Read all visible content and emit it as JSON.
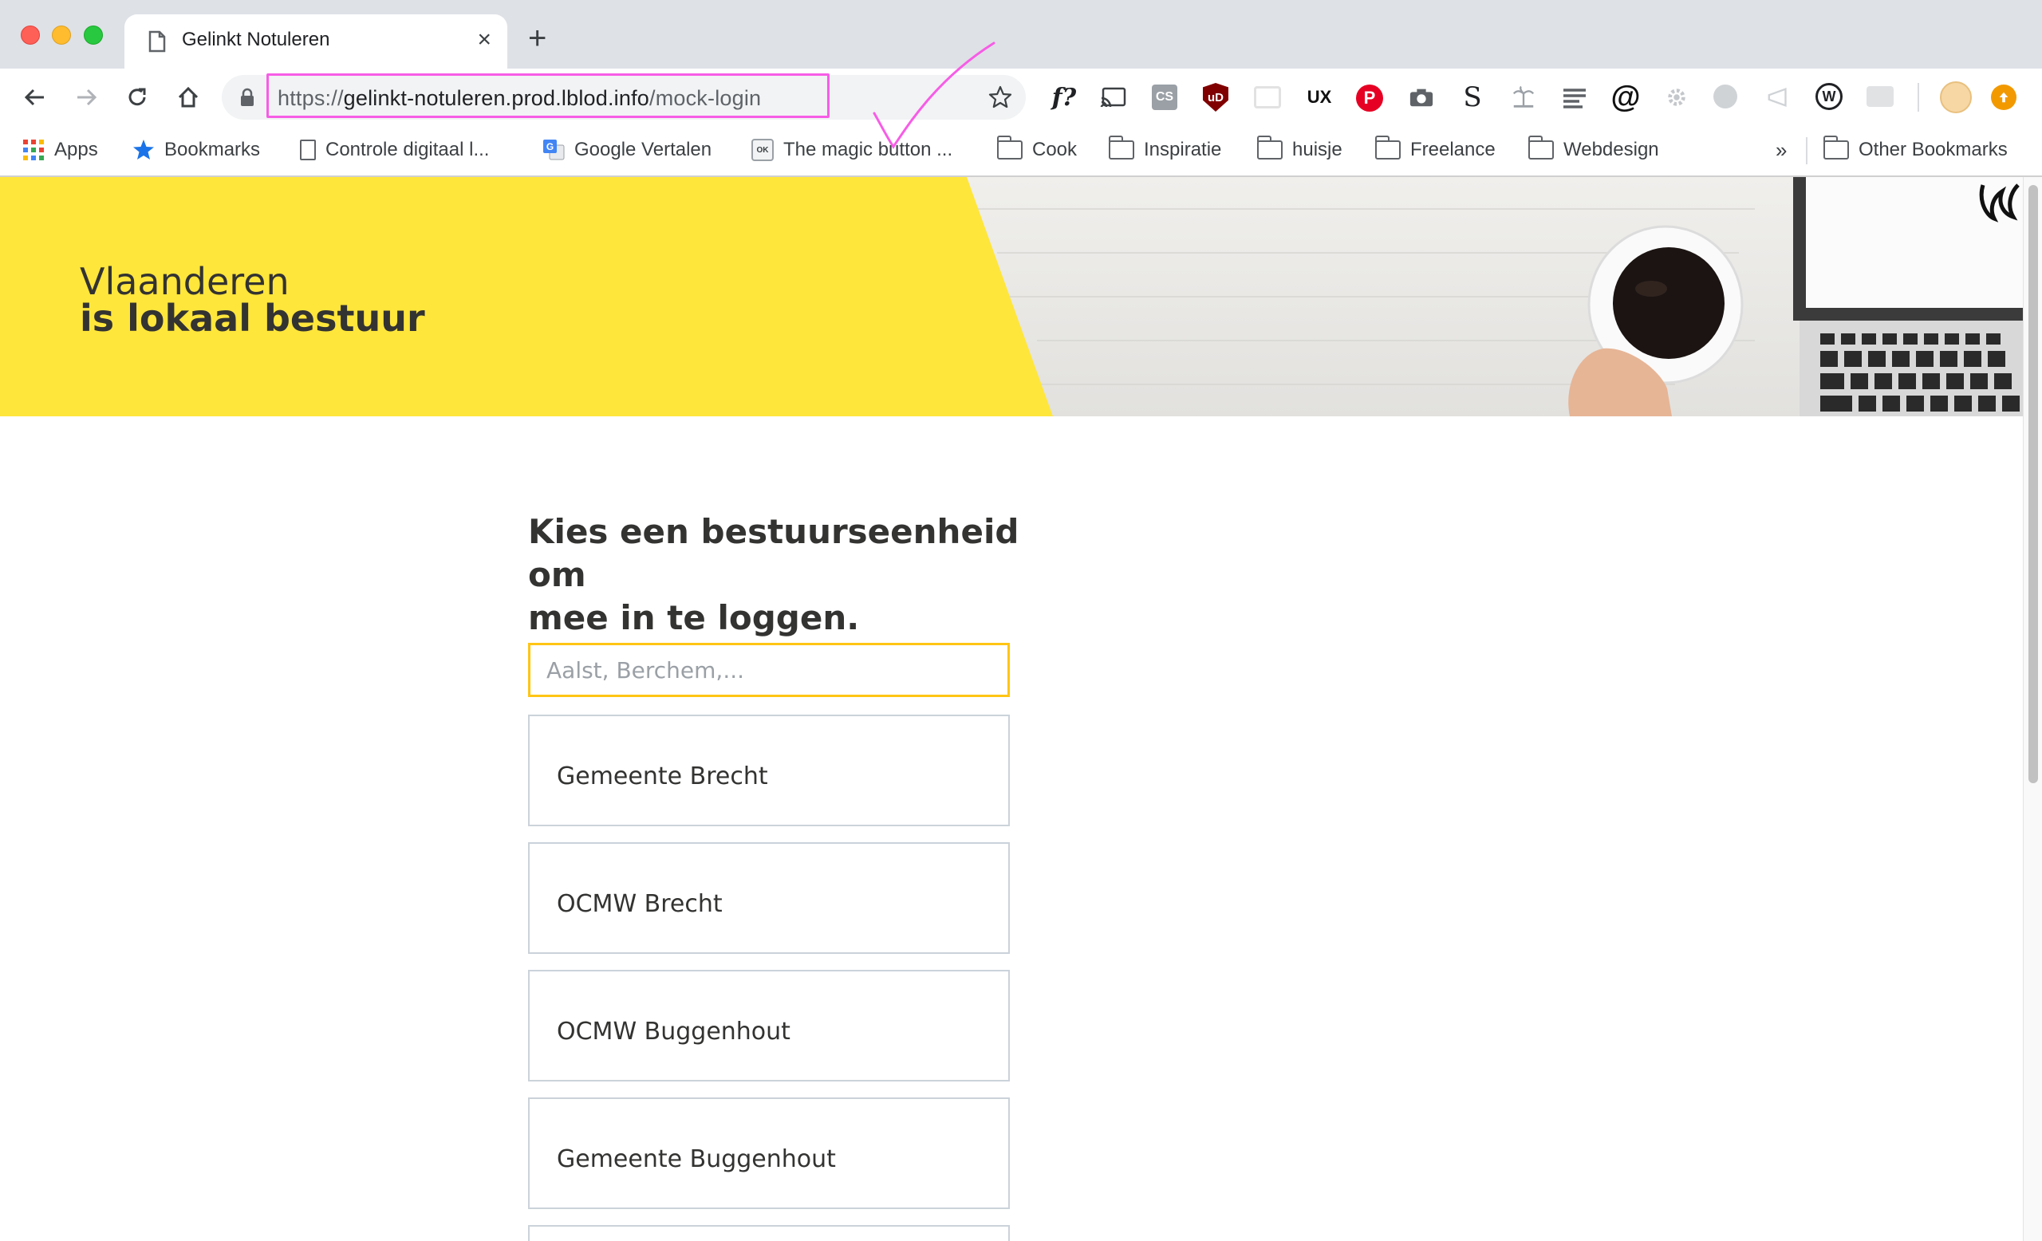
{
  "tab": {
    "title": "Gelinkt Notuleren",
    "close": "×",
    "new_tab": "+"
  },
  "address": {
    "scheme": "https://",
    "host": "gelinkt-notuleren.prod.lblod.info",
    "path": "/mock-login"
  },
  "extensions": {
    "fq_label": "f?",
    "lastfm_label": "CS",
    "ublock_label": "uD",
    "ux_label": "UX",
    "pinterest_label": "P",
    "s_label": "S",
    "at_label": "@",
    "w_label": "W"
  },
  "bookmarks": {
    "items": [
      {
        "label": "Apps",
        "icon": "apps-grid-icon"
      },
      {
        "label": "Bookmarks",
        "icon": "star-icon"
      },
      {
        "label": "Controle digitaal l...",
        "icon": "page-icon"
      },
      {
        "label": "Google Vertalen",
        "icon": "google-translate-icon"
      },
      {
        "label": "The magic button ...",
        "icon": "ok-icon"
      },
      {
        "label": "Cook",
        "icon": "folder-icon"
      },
      {
        "label": "Inspiratie",
        "icon": "folder-icon"
      },
      {
        "label": "huisje",
        "icon": "folder-icon"
      },
      {
        "label": "Freelance",
        "icon": "folder-icon"
      },
      {
        "label": "Webdesign",
        "icon": "folder-icon"
      }
    ],
    "overflow": "»",
    "other": "Other Bookmarks"
  },
  "banner": {
    "line1": "Vlaanderen",
    "line2": "is lokaal bestuur"
  },
  "login": {
    "heading_line1": "Kies een bestuurseenheid om",
    "heading_line2": "mee in te loggen.",
    "search_placeholder": "Aalst, Berchem,...",
    "options": [
      "Gemeente Brecht",
      "OCMW Brecht",
      "OCMW Buggenhout",
      "Gemeente Buggenhout"
    ]
  },
  "colors": {
    "brand_yellow": "#ffe63b",
    "focus_border": "#ffc515",
    "annotation_magenta": "#f75ce6",
    "text_dark": "#333332"
  }
}
